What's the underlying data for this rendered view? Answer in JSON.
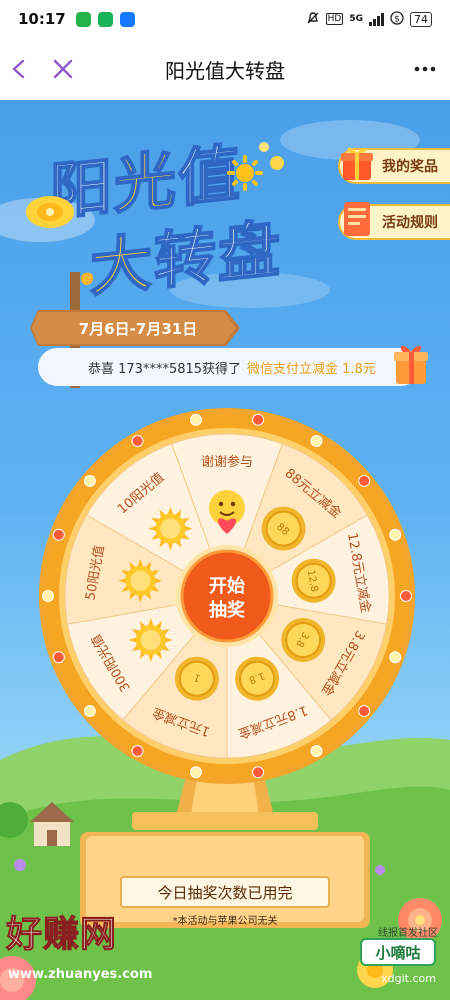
{
  "status_bar": {
    "time": "10:17",
    "network": "5G",
    "battery": "74"
  },
  "nav": {
    "title": "阳光值大转盘"
  },
  "banner": {
    "title_line1": [
      "阳",
      "光",
      "值"
    ],
    "title_line2": [
      "大",
      "转",
      "盘"
    ],
    "date_range": "7月6日-7月31日"
  },
  "side_buttons": {
    "my_prizes": "我的奖品",
    "rules": "活动规则"
  },
  "ticker": {
    "text": "恭喜 173****5815获得了",
    "prize": "微信支付立减金 1.8元"
  },
  "wheel": {
    "center_line1": "开始",
    "center_line2": "抽奖",
    "segments": [
      {
        "label": "谢谢参与",
        "icon": "smiley-heart-icon",
        "coin": ""
      },
      {
        "label": "88元立减金",
        "icon": "coin-icon",
        "coin": "88"
      },
      {
        "label": "12.8元立减金",
        "icon": "coin-icon",
        "coin": "12.8"
      },
      {
        "label": "3.8元立减金",
        "icon": "coin-icon",
        "coin": "3.8"
      },
      {
        "label": "1.8元立减金",
        "icon": "coin-icon",
        "coin": "1.8"
      },
      {
        "label": "1元立减金",
        "icon": "coin-icon",
        "coin": "1"
      },
      {
        "label": "300阳光值",
        "icon": "sun-icon",
        "coin": ""
      },
      {
        "label": "50阳光值",
        "icon": "sun-icon",
        "coin": ""
      },
      {
        "label": "10阳光值",
        "icon": "sun-icon",
        "coin": ""
      }
    ]
  },
  "draw_status": "今日抽奖次数已用完",
  "disclaimer": "*本活动与苹果公司无关",
  "watermarks": {
    "left": "好赚网",
    "left_url": "www.zhuanyes.com",
    "right_top": "线报首发社区",
    "right_badge": "小嘀咕",
    "right_url": "xdgit.com"
  },
  "colors": {
    "sky": "#4a9fe9",
    "wheel_rim": "#f5a623",
    "wheel_inner": "#fff3df",
    "wheel_inner_alt": "#ffe7c2",
    "center": "#f05a1a",
    "accent_text": "#e8a311"
  }
}
